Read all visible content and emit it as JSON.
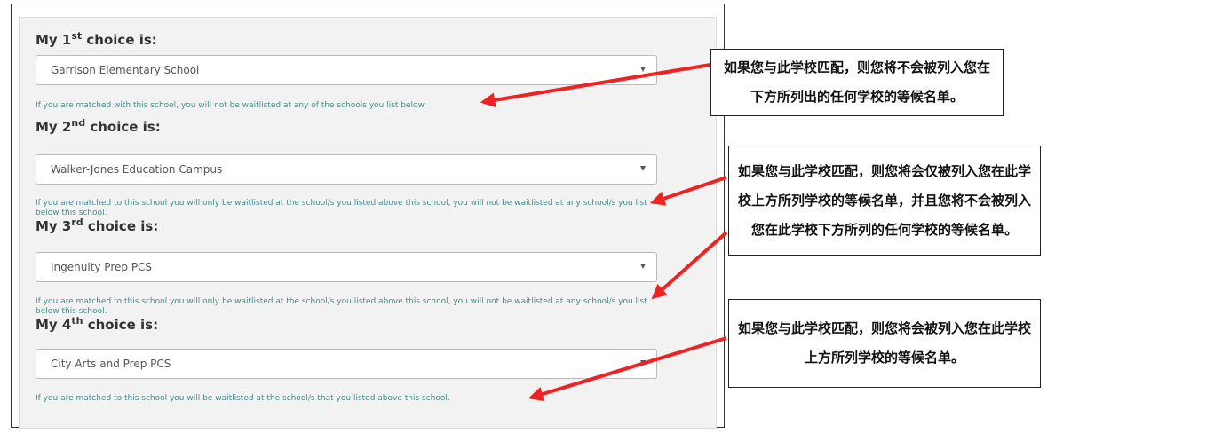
{
  "choices": [
    {
      "prefix": "My 1",
      "ordinal": "st",
      "suffix": " choice is:",
      "selected": "Garrison Elementary School",
      "help": "If you are matched with this school, you will not be waitlisted at any of the schools you list below."
    },
    {
      "prefix": "My 2",
      "ordinal": "nd",
      "suffix": " choice is:",
      "selected": "Walker-Jones Education Campus",
      "help": "If you are matched to this school you will only be waitlisted at the school/s you listed above this school, you will not be waitlisted at any school/s you list below this school."
    },
    {
      "prefix": "My 3",
      "ordinal": "rd",
      "suffix": " choice is:",
      "selected": "Ingenuity Prep PCS",
      "help": "If you are matched to this school you will only be waitlisted at the school/s you listed above this school, you will not be waitlisted at any school/s you list below this school."
    },
    {
      "prefix": "My 4",
      "ordinal": "th",
      "suffix": " choice is:",
      "selected": "City Arts and Prep PCS",
      "help": "If you are matched to this school you will be waitlisted at the school/s that you listed above this school."
    }
  ],
  "callouts": [
    "如果您与此学校匹配，则您将不会被列入您在下方所列出的任何学校的等候名单。",
    "如果您与此学校匹配，则您将会仅被列入您在此学校上方所列学校的等候名单，并且您将不会被列入您在此学校下方所列的任何学校的等候名单。",
    "如果您与此学校匹配，则您将会被列入您在此学校上方所列学校的等候名单。"
  ],
  "colors": {
    "arrow": "#ee2222",
    "help_text": "#4a8a8a"
  }
}
